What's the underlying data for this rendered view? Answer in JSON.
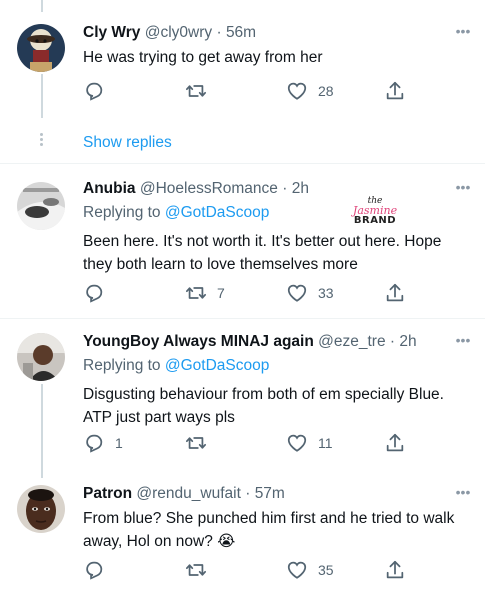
{
  "tweets": [
    {
      "name": "Cly Wry",
      "handle": "@cly0wry",
      "time": "56m",
      "replying_to_label": "",
      "replying_to_handle": "",
      "text": "He was trying to get away from her",
      "replies": "",
      "retweets": "",
      "likes": "28"
    },
    {
      "name": "Anubia",
      "handle": "@HoelessRomance",
      "time": "2h",
      "replying_to_label": "Replying to",
      "replying_to_handle": "@GotDaScoop",
      "text": "Been here. It's not worth it. It's better out here. Hope they both learn to love themselves more",
      "replies": "",
      "retweets": "7",
      "likes": "33"
    },
    {
      "name": "YoungBoy Always MINAJ again",
      "handle": "@eze_tre",
      "time": "2h",
      "replying_to_label": "Replying to",
      "replying_to_handle": "@GotDaScoop",
      "text": "Disgusting behaviour from both of em specially Blue. ATP just part ways pls",
      "replies": "1",
      "retweets": "",
      "likes": "11"
    },
    {
      "name": "Patron",
      "handle": "@rendu_wufait",
      "time": "57m",
      "replying_to_label": "",
      "replying_to_handle": "",
      "text": "From blue? She punched him first and he tried to walk away, Hol on now? 😭",
      "replies": "",
      "retweets": "",
      "likes": "35"
    }
  ],
  "show_replies": "Show replies",
  "watermark": {
    "line1": "the",
    "line2": "Jasmine",
    "line3": "BRAND"
  },
  "colors": {
    "accent": "#1d9bf0",
    "secondary_text": "#536471",
    "divider": "#eff3f4",
    "watermark_pink": "#e0457b"
  },
  "icons": {
    "reply": "reply-icon",
    "retweet": "retweet-icon",
    "like": "heart-icon",
    "share": "share-icon",
    "more": "more-icon"
  }
}
